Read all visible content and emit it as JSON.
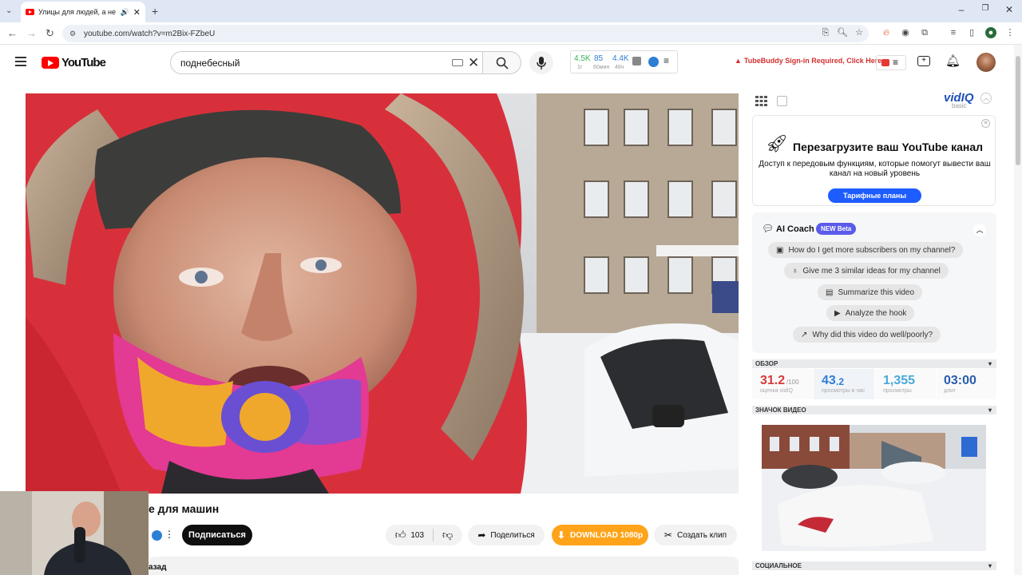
{
  "browser": {
    "tab_title": "Улицы для людей, а не для",
    "url": "youtube.com/watch?v=m2Bix-FZbeU"
  },
  "youtube": {
    "logo_text": "YouTube",
    "search_value": "поднебесный",
    "tubebuddy_notice": "TubeBuddy Sign-in Required, Click Here"
  },
  "vidiq_bar": {
    "v1": "4.5K",
    "v2": "85",
    "v3": "4.4K",
    "l1": "1г",
    "l2": "60мин",
    "l3": "48ч"
  },
  "video": {
    "title": "е для машин",
    "subscribe": "Подписаться",
    "likes": "103",
    "share": "Поделиться",
    "download": "DOWNLOAD 1080p",
    "clip": "Создать клип",
    "desc_fragment": "азад"
  },
  "sidebar": {
    "vidiq_logo": "vidIQ",
    "vidiq_tier": "basic",
    "promo_title": "Перезагрузите ваш YouTube канал",
    "promo_text": "Доступ к передовым функциям, которые помогут вывести ваш канал на новый уровень",
    "promo_button": "Тарифные планы",
    "ai_coach_title": "AI Coach",
    "ai_coach_badge": "NEW Beta",
    "ai_questions": [
      "How do I get more subscribers on my channel?",
      "Give me 3 similar ideas for my channel",
      "Summarize this video",
      "Analyze the hook",
      "Why did this video do well/poorly?"
    ],
    "overview_label": "ОБЗОР",
    "score": "31.2",
    "score_suffix": "/100",
    "score_label": "оценка vidIQ",
    "vph_main": "43",
    "vph_dec": ".2",
    "vph_label": "просмотры в час",
    "views": "1,355",
    "views_label": "просмотры",
    "length": "03:00",
    "length_label": "длит",
    "thumb_label": "ЗНАЧОК ВИДЕО",
    "social_label": "СОЦИАЛЬНОЕ"
  },
  "colors": {
    "yt_red": "#ff0000",
    "vidiq_blue": "#1d5cff",
    "download_orange": "#ffa41a",
    "score_red": "#d63a3a",
    "stat_blue": "#2d7fd3"
  }
}
